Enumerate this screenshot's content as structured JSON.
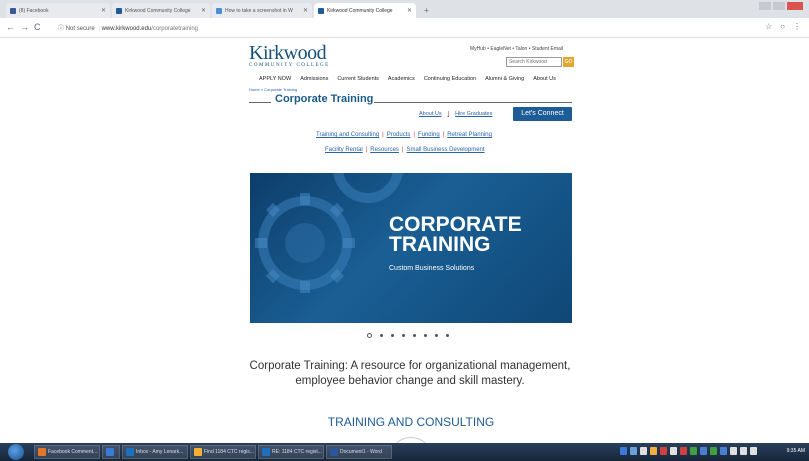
{
  "browser": {
    "tabs": [
      {
        "label": "(8) Facebook",
        "color": "#3b5998"
      },
      {
        "label": "Kirkwood Community College",
        "color": "#1d5c96"
      },
      {
        "label": "How to take a screenshot in W",
        "color": "#4a8fd8"
      },
      {
        "label": "Kirkwood Community College",
        "color": "#1d5c96"
      }
    ],
    "new_tab_label": "+",
    "address": {
      "security": "Not secure",
      "host": "www.kirkwood.edu",
      "path": "/corporatetraining"
    }
  },
  "site": {
    "logo_main": "Kirkwood",
    "logo_sub": "COMMUNITY COLLEGE",
    "top_links": "MyHub • EagleNet • Talon • Student Email",
    "search_placeholder": "Search Kirkwood",
    "search_go": "GO",
    "main_nav": [
      "APPLY NOW",
      "Admissions",
      "Current Students",
      "Academics",
      "Continuing Education",
      "Alumni & Giving",
      "About Us"
    ],
    "breadcrumb": "Home » Corporate Training",
    "page_heading": "Corporate Training",
    "about_us": "About Us",
    "hire_graduates": "Hire Graduates",
    "separator": "|",
    "connect_button": "Let's Connect",
    "links_row1": [
      "Training and Consulting",
      "Products",
      "Funding",
      "Retreat Planning"
    ],
    "links_row2": [
      "Facility Rental",
      "Resources",
      "Small Business Development"
    ],
    "hero": {
      "title_line1": "CORPORATE",
      "title_line2": "TRAINING",
      "subtitle": "Custom Business Solutions"
    },
    "carousel": {
      "count": 8,
      "active": 0
    },
    "tagline": "Corporate Training: A resource for organizational management, employee behavior change and skill mastery.",
    "section_title": "TRAINING AND CONSULTING"
  },
  "taskbar": {
    "items": [
      {
        "label": "Facebook Comment...",
        "color": "#e2762d"
      },
      {
        "label": "",
        "color": "#3a7bd5"
      },
      {
        "label": "Inbox - Amy Lenark...",
        "color": "#1f6fbf"
      },
      {
        "label": "Find 1184 CTC regis...",
        "color": "#f2b134"
      },
      {
        "label": "RE: 1184 CTC regist...",
        "color": "#1f6fbf"
      },
      {
        "label": "Document1 - Word",
        "color": "#2b579a"
      }
    ],
    "clock": "9:35 AM"
  }
}
